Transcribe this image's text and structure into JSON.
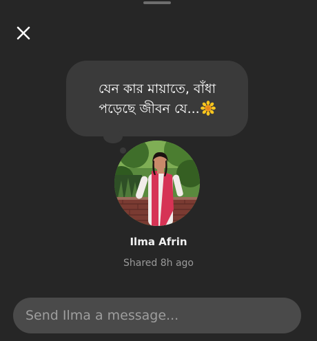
{
  "story_reply": {
    "note_text": "যেন কার মায়াতে, বাঁধা\nপড়েছে জীবন যে...",
    "note_emoji": "sunflower-icon",
    "user_name": "Ilma Afrin",
    "shared_time": "Shared 8h ago",
    "message_placeholder": "Send Ilma a message..."
  },
  "colors": {
    "background": "#262626",
    "bubble": "#3a3a3a",
    "input_bg": "#4a4a4a",
    "muted_text": "#9a9a9a"
  }
}
